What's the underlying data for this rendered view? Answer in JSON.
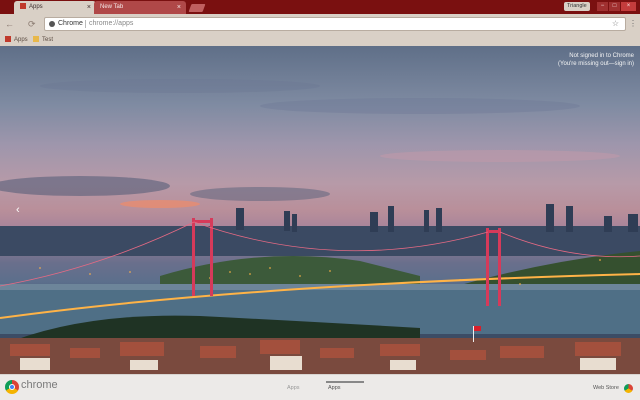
{
  "window": {
    "tabs": [
      {
        "title": "Apps",
        "close": "×"
      },
      {
        "title": "New Tab",
        "close": "×"
      }
    ],
    "profile_name": "Triangle",
    "controls": {
      "minimize": "−",
      "maximize": "□",
      "close": "×"
    }
  },
  "toolbar": {
    "back": "←",
    "reload": "⟳",
    "omnibox_label": "Chrome",
    "omnibox_url": "chrome://apps",
    "star": "☆",
    "menu": "⋮"
  },
  "bookmarks": [
    {
      "label": "Apps",
      "icon": "apps-grid-icon",
      "color": "#c0392b"
    },
    {
      "label": "Test",
      "icon": "folder-icon",
      "color": "#e8b84a"
    }
  ],
  "content": {
    "signin_line1": "Not signed in to Chrome",
    "signin_line2": "(You're missing out—sign in)",
    "prev_arrow": "‹"
  },
  "footer": {
    "brand": "chrome",
    "pages": [
      "Apps",
      "Apps"
    ],
    "webstore": "Web Store"
  },
  "colors": {
    "titlebar": "#7a1010",
    "toolbar": "#d9d0c6",
    "bridge": "#d63a5a",
    "city_lights": "#ffb347"
  }
}
